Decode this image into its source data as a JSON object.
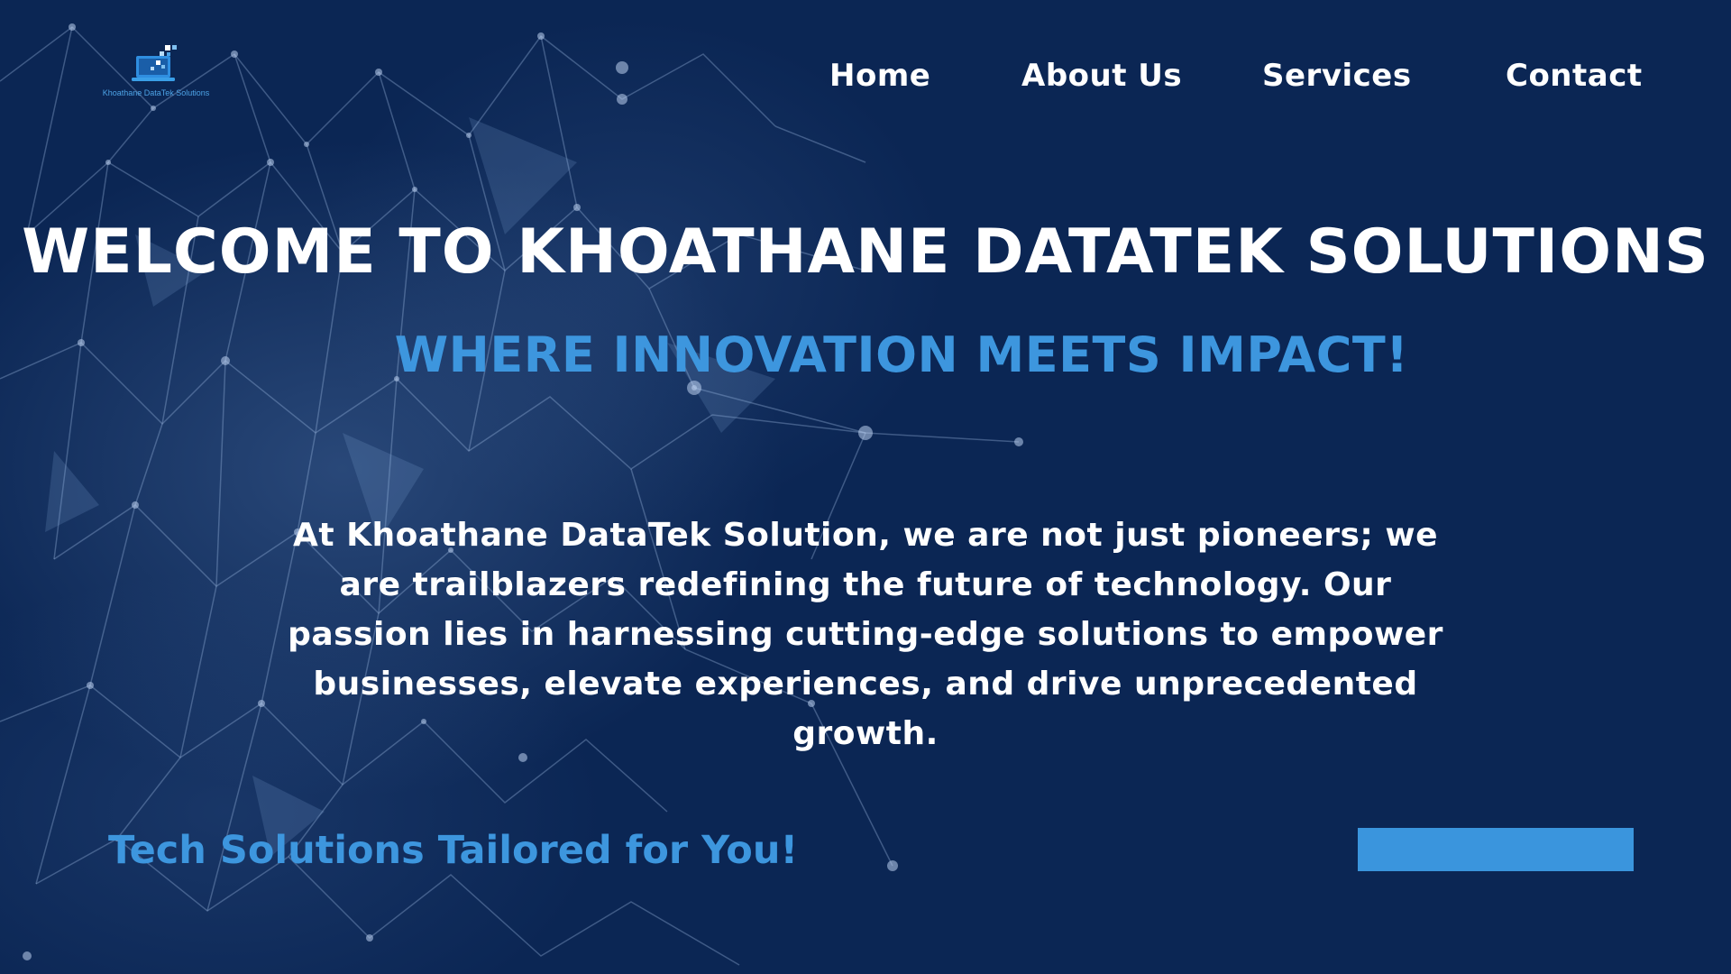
{
  "brand": {
    "logo_text": "Khoathane DataTek Solutions",
    "logo_tagline": "",
    "colors": {
      "background": "#0b2654",
      "accent": "#3d96de",
      "text": "#ffffff"
    }
  },
  "nav": {
    "items": [
      {
        "label": "Home"
      },
      {
        "label": "About Us"
      },
      {
        "label": "Services"
      },
      {
        "label": "Contact"
      }
    ]
  },
  "hero": {
    "title": "WELCOME TO KHOATHANE DATATEK SOLUTIONS",
    "subtitle": "WHERE INNOVATION MEETS IMPACT!",
    "body": "At Khoathane DataTek Solution, we are not just pioneers; we are trailblazers redefining the future of technology. Our passion lies in harnessing cutting-edge solutions to empower businesses, elevate experiences, and drive unprecedented growth."
  },
  "footer": {
    "tagline": "Tech Solutions Tailored for You!",
    "cta_label": ""
  }
}
